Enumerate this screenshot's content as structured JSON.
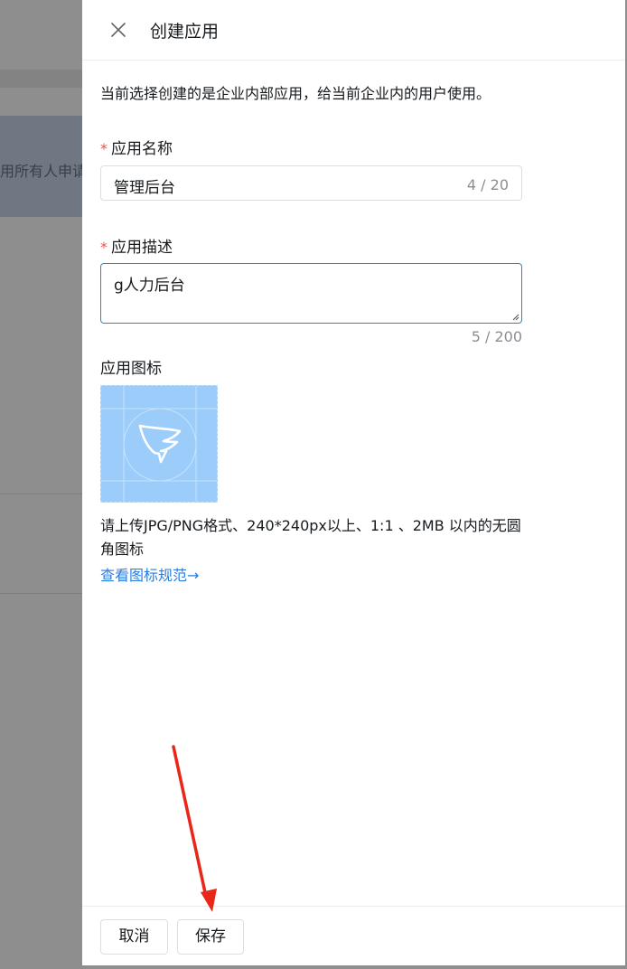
{
  "background": {
    "card_text": "用所有人申请"
  },
  "drawer": {
    "title": "创建应用",
    "notice": "当前选择创建的是企业内部应用，给当前企业内的用户使用。",
    "name_field": {
      "required_mark": "*",
      "label": "应用名称",
      "value": "管理后台",
      "counter": "4 / 20"
    },
    "desc_field": {
      "required_mark": "*",
      "label": "应用描述",
      "value": "g人力后台",
      "counter": "5 / 200"
    },
    "icon_field": {
      "label": "应用图标",
      "icon": "dingtalk-wing-logo-icon",
      "hint": "请上传JPG/PNG格式、240*240px以上、1:1 、2MB 以内的无圆角图标",
      "spec_link": "查看图标规范→"
    },
    "footer": {
      "cancel_label": "取消",
      "save_label": "保存"
    }
  },
  "colors": {
    "accent": "#2a7de1",
    "required": "#f0504d",
    "icon_bg": "#9ccdfa",
    "annotation_arrow": "#e8261a"
  }
}
